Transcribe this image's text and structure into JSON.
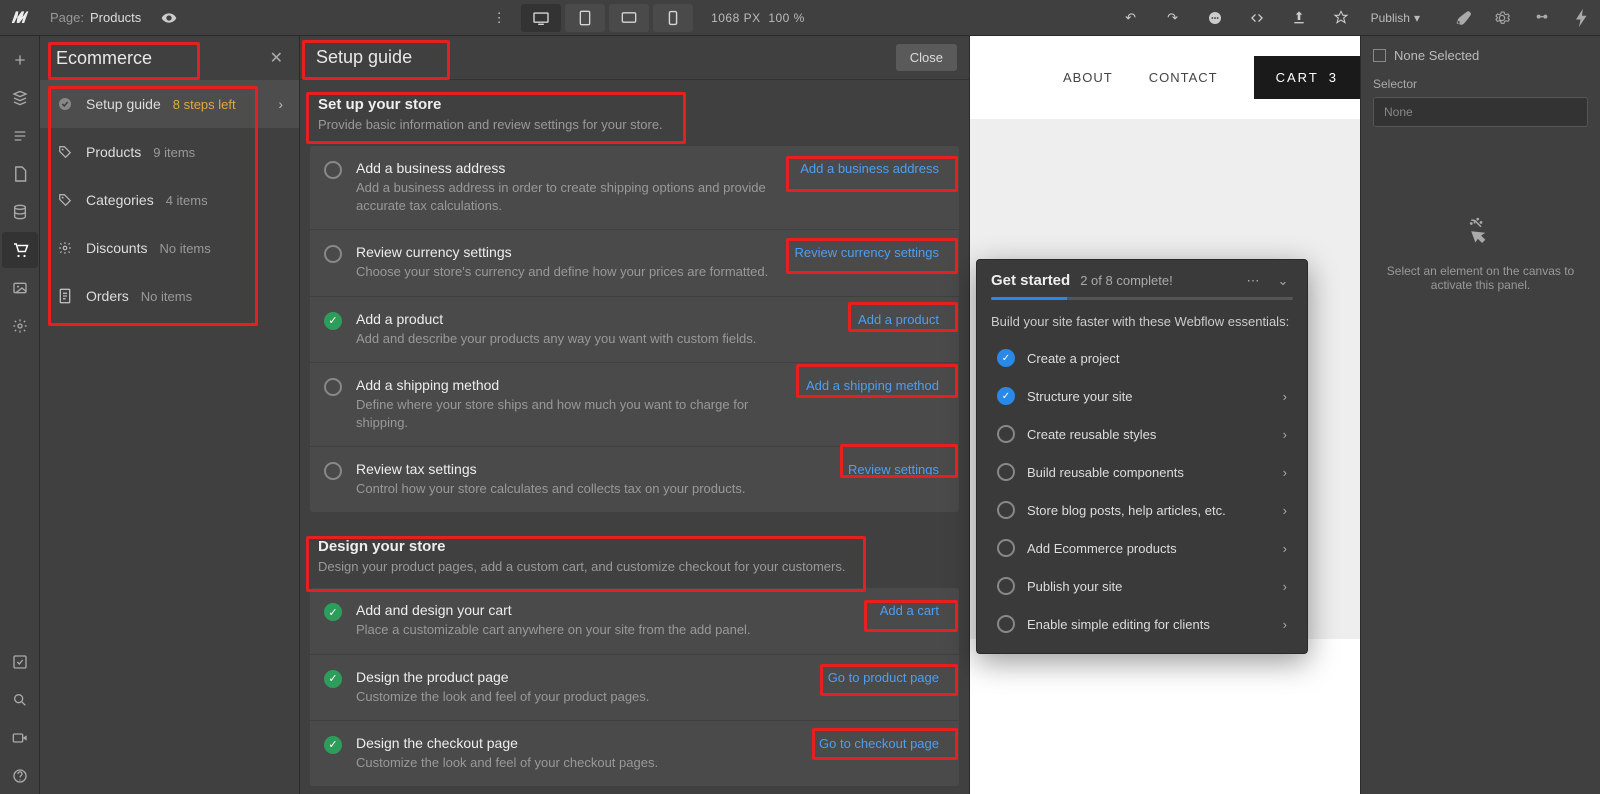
{
  "topbar": {
    "page_label": "Page:",
    "page_name": "Products",
    "canvas_width": "1068",
    "canvas_unit": "PX",
    "zoom": "100 %",
    "publish_label": "Publish"
  },
  "leftrail": {},
  "ecommerce_panel": {
    "title": "Ecommerce",
    "items": [
      {
        "icon": "check",
        "label": "Setup guide",
        "meta": "8 steps left",
        "meta_class": "orange",
        "active": true,
        "chev": true
      },
      {
        "icon": "tag",
        "label": "Products",
        "meta": "9 items"
      },
      {
        "icon": "tag",
        "label": "Categories",
        "meta": "4 items"
      },
      {
        "icon": "gear",
        "label": "Discounts",
        "meta": "No items"
      },
      {
        "icon": "doc",
        "label": "Orders",
        "meta": "No items"
      }
    ]
  },
  "setup_panel": {
    "title": "Setup guide",
    "close": "Close",
    "sections": [
      {
        "title": "Set up your store",
        "desc": "Provide basic information and review settings for your store.",
        "steps": [
          {
            "done": false,
            "title": "Add a business address",
            "desc": "Add a business address in order to create shipping options and provide accurate tax calculations.",
            "link": "Add a business address"
          },
          {
            "done": false,
            "title": "Review currency settings",
            "desc": "Choose your store's currency and define how your prices are formatted.",
            "link": "Review currency settings"
          },
          {
            "done": true,
            "title": "Add a product",
            "desc": "Add and describe your products any way you want with custom fields.",
            "link": "Add a product"
          },
          {
            "done": false,
            "title": "Add a shipping method",
            "desc": "Define where your store ships and how much you want to charge for shipping.",
            "link": "Add a shipping method"
          },
          {
            "done": false,
            "title": "Review tax settings",
            "desc": "Control how your store calculates and collects tax on your products.",
            "link": "Review settings"
          }
        ]
      },
      {
        "title": "Design your store",
        "desc": "Design your product pages, add a custom cart, and customize checkout for your customers.",
        "steps": [
          {
            "done": true,
            "title": "Add and design your cart",
            "desc": "Place a customizable cart anywhere on your site from the add panel.",
            "link": "Add a cart"
          },
          {
            "done": true,
            "title": "Design the product page",
            "desc": "Customize the look and feel of your product pages.",
            "link": "Go to product page"
          },
          {
            "done": true,
            "title": "Design the checkout page",
            "desc": "Customize the look and feel of your checkout pages.",
            "link": "Go to checkout page"
          }
        ]
      }
    ]
  },
  "canvas": {
    "nav": [
      {
        "label": "ABOUT"
      },
      {
        "label": "CONTACT"
      }
    ],
    "cart_label": "CART",
    "cart_count": "3"
  },
  "get_started": {
    "title": "Get started",
    "progress": "2 of 8 complete!",
    "desc": "Build your site faster with these Webflow essentials:",
    "items": [
      {
        "done": true,
        "label": "Create a project",
        "chev": false
      },
      {
        "done": true,
        "label": "Structure your site",
        "chev": true
      },
      {
        "done": false,
        "label": "Create reusable styles",
        "chev": true
      },
      {
        "done": false,
        "label": "Build reusable components",
        "chev": true
      },
      {
        "done": false,
        "label": "Store blog posts, help articles, etc.",
        "chev": true
      },
      {
        "done": false,
        "label": "Add Ecommerce products",
        "chev": true
      },
      {
        "done": false,
        "label": "Publish your site",
        "chev": true
      },
      {
        "done": false,
        "label": "Enable simple editing for clients",
        "chev": true
      }
    ]
  },
  "inspector": {
    "none_selected": "None Selected",
    "selector_label": "Selector",
    "selector_value": "None",
    "placeholder_text": "Select an element on the canvas to activate this panel."
  }
}
